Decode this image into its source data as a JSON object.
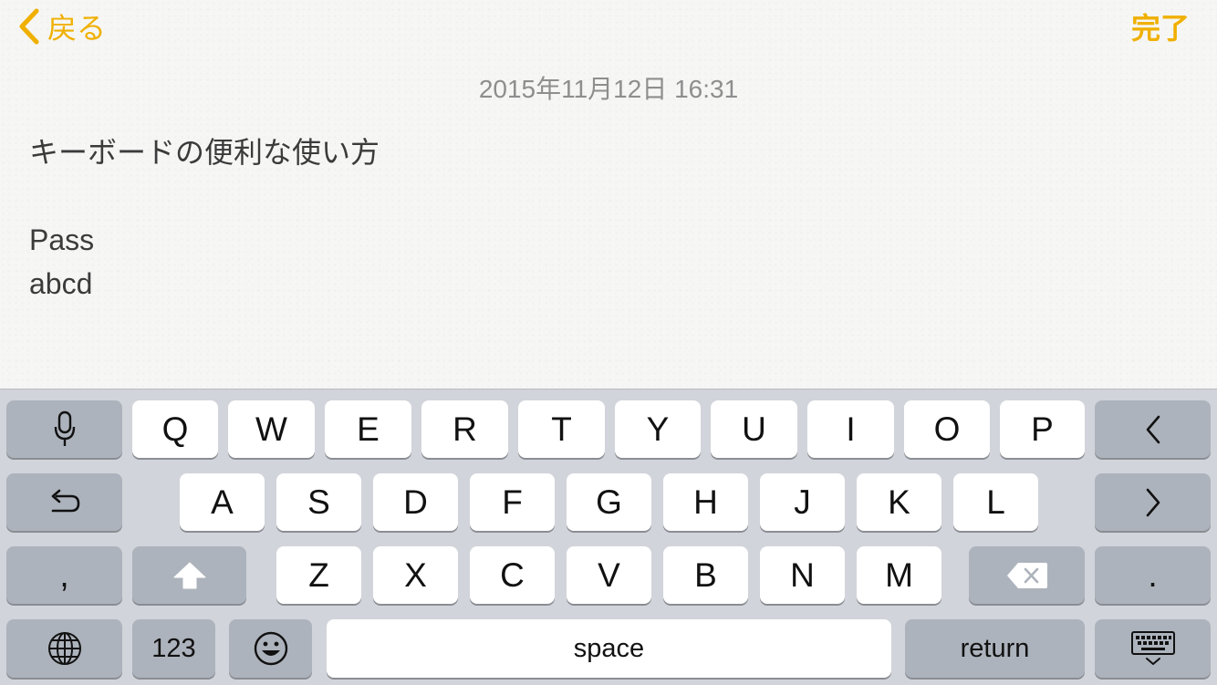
{
  "nav": {
    "back_label": "戻る",
    "done_label": "完了"
  },
  "note": {
    "date": "2015年11月12日 16:31",
    "lines": [
      "キーボードの便利な使い方",
      "",
      "Pass",
      "abcd"
    ]
  },
  "keyboard": {
    "row1": [
      "Q",
      "W",
      "E",
      "R",
      "T",
      "Y",
      "U",
      "I",
      "O",
      "P"
    ],
    "row2": [
      "A",
      "S",
      "D",
      "F",
      "G",
      "H",
      "J",
      "K",
      "L"
    ],
    "row3": [
      "Z",
      "X",
      "C",
      "V",
      "B",
      "N",
      "M"
    ],
    "comma": ",",
    "period": ".",
    "numbers_label": "123",
    "space_label": "space",
    "return_label": "return",
    "icons": {
      "mic": "microphone-icon",
      "undo": "undo-icon",
      "shift": "shift-icon",
      "globe": "globe-icon",
      "emoji": "emoji-icon",
      "left": "cursor-left-icon",
      "right": "cursor-right-icon",
      "delete": "backspace-icon",
      "hide": "keyboard-dismiss-icon"
    }
  },
  "colors": {
    "accent": "#f0b000",
    "key_light": "#ffffff",
    "key_dark": "#adb3bc",
    "keyboard_bg": "#d1d4da"
  }
}
